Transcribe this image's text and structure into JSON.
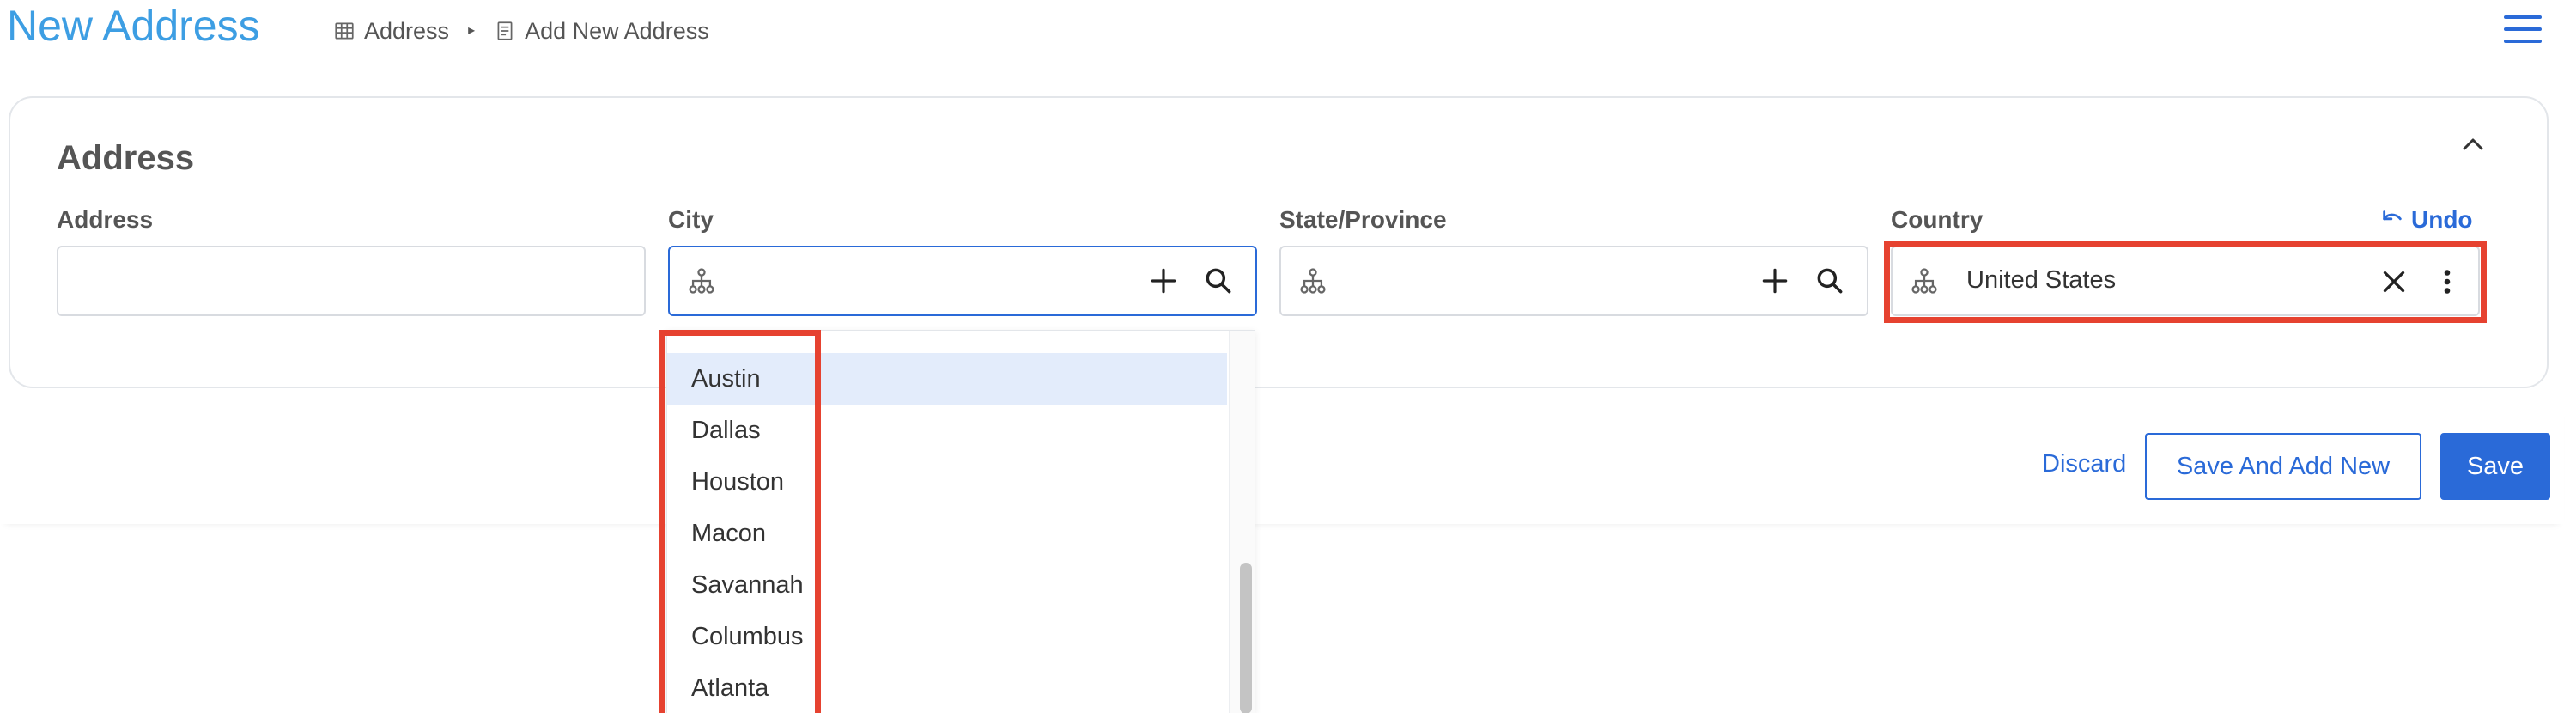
{
  "header": {
    "title": "New Address",
    "breadcrumb": [
      {
        "label": "Address",
        "icon": "table-grid-icon"
      },
      {
        "label": "Add New Address",
        "icon": "document-icon"
      }
    ],
    "menu_icon": "hamburger-menu-icon"
  },
  "form": {
    "section_title": "Address",
    "fields": {
      "address": {
        "label": "Address",
        "value": ""
      },
      "city": {
        "label": "City",
        "value": ""
      },
      "state": {
        "label": "State/Province",
        "value": ""
      },
      "country": {
        "label": "Country",
        "value": "United States"
      }
    },
    "undo_label": "Undo"
  },
  "city_dropdown": {
    "options": [
      "Austin",
      "Dallas",
      "Houston",
      "Macon",
      "Savannah",
      "Columbus",
      "Atlanta"
    ],
    "active_index": 0
  },
  "actions": {
    "discard": "Discard",
    "save_and_add_new": "Save And Add New",
    "save": "Save"
  },
  "colors": {
    "accent": "#2a6ad8",
    "title": "#3d9ee3",
    "highlight": "#e64230",
    "active_option": "#e3ecfb"
  }
}
